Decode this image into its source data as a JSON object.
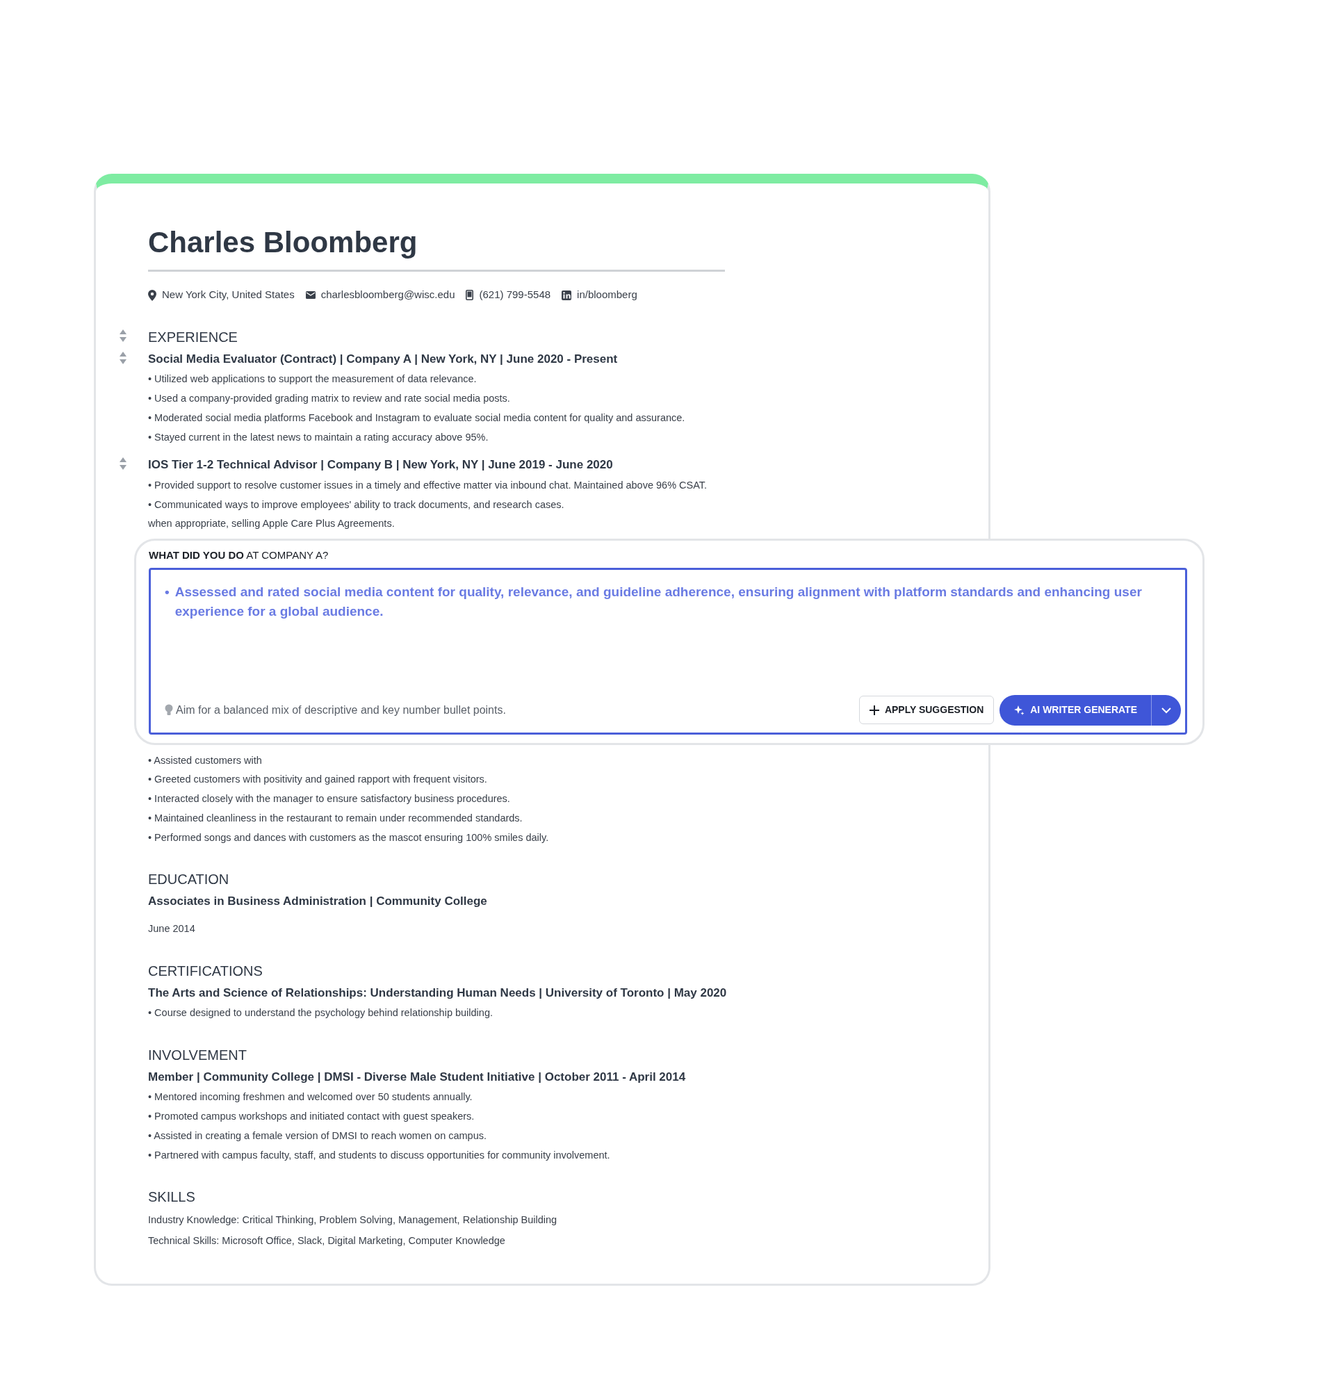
{
  "resume": {
    "name": "Charles Bloomberg",
    "contact": [
      {
        "kind": "location",
        "text": "New York City,  United States"
      },
      {
        "kind": "email",
        "text": "charlesbloomberg@wisc.edu"
      },
      {
        "kind": "phone",
        "text": "(621) 799-5548"
      },
      {
        "kind": "linkedin",
        "text": "in/bloomberg"
      }
    ],
    "sections": [
      {
        "title": "EXPERIENCE",
        "drag_handle": true,
        "entries": [
          {
            "kind": "job",
            "drag_handle": true,
            "heading": "Social Media Evaluator (Contract) | Company A | New York, NY | June 2020 - Present",
            "bullets": [
              "• Utilized web applications to support the measurement of data relevance.",
              "• Used a company-provided grading matrix to review and rate social media posts.",
              "• Moderated social media platforms Facebook and Instagram to evaluate social media content for quality and assurance.",
              "• Stayed current in the latest news to maintain a rating accuracy above 95%."
            ]
          },
          {
            "kind": "job",
            "drag_handle": true,
            "heading": "IOS Tier 1-2 Technical Advisor  | Company B | New York, NY | June 2019 - June 2020",
            "bullets": [
              "• Provided support to resolve customer issues in a timely and effective matter via inbound chat. Maintained above 96% CSAT.",
              "• Communicated ways to improve employees' ability to track documents, and research cases.",
              "when appropriate, selling Apple Care Plus Agreements."
            ]
          },
          {
            "kind": "editor",
            "label": "**WHAT DID YOU DO** AT COMPANY A?",
            "suggestion": "Assessed and rated social media content for quality, relevance, and guideline adherence, ensuring alignment with platform standards and enhancing user experience for a global audience.",
            "bullet": "•",
            "hint": "Aim for a balanced mix of descriptive and key number bullet points.",
            "apply_button": "APPLY SUGGESTION",
            "generate_button": "AI WRITER GENERATE"
          },
          {
            "kind": "job",
            "drag_handle": false,
            "bullets": [
              "• Assisted customers with",
              "• Greeted customers with positivity and gained rapport with frequent visitors.",
              "• Interacted closely with the manager to ensure satisfactory business procedures.",
              "• Maintained cleanliness in the restaurant to remain under recommended standards.",
              "• Performed songs and dances with customers as the mascot ensuring 100% smiles daily."
            ]
          }
        ]
      },
      {
        "title": "EDUCATION",
        "drag_handle": false,
        "entries": [
          {
            "kind": "job",
            "drag_handle": false,
            "heading": "Associates in Business Administration |  Community College",
            "date": "June 2014"
          }
        ]
      },
      {
        "title": "CERTIFICATIONS",
        "drag_handle": false,
        "entries": [
          {
            "kind": "job",
            "drag_handle": false,
            "heading": "The Arts and Science of Relationships: Understanding Human Needs | University of Toronto | May 2020",
            "bullets": [
              "• Course designed to understand the psychology behind relationship building."
            ]
          }
        ]
      },
      {
        "title": "INVOLVEMENT",
        "drag_handle": false,
        "entries": [
          {
            "kind": "job",
            "drag_handle": false,
            "heading": "Member |  Community College | DMSI - Diverse Male Student Initiative | October 2011 - April 2014",
            "bullets": [
              "• Mentored incoming freshmen and welcomed over 50 students annually.",
              "• Promoted campus workshops and initiated contact with guest speakers.",
              "• Assisted in creating a female version of DMSI to reach women on campus.",
              "• Partnered with campus faculty, staff, and students to discuss opportunities for community involvement."
            ]
          }
        ]
      },
      {
        "title": "SKILLS",
        "drag_handle": false,
        "entries": [
          {
            "kind": "skills",
            "lines": [
              "Industry Knowledge: Critical Thinking, Problem Solving, Management, Relationship Building",
              "Technical Skills: Microsoft Office, Slack, Digital Marketing, Computer Knowledge"
            ]
          }
        ]
      }
    ]
  }
}
